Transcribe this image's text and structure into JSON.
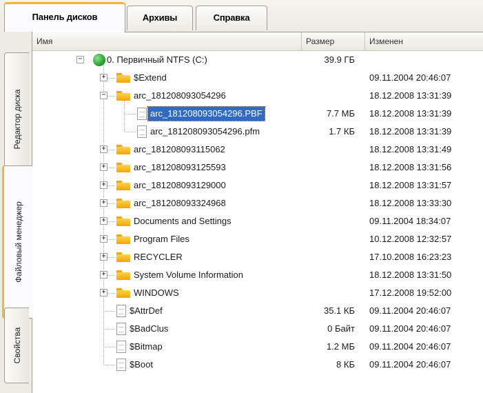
{
  "tabs": [
    {
      "label": "Панель дисков",
      "active": true
    },
    {
      "label": "Архивы",
      "active": false
    },
    {
      "label": "Справка",
      "active": false
    }
  ],
  "side_tabs": [
    {
      "label": "Редактор диска",
      "active": false
    },
    {
      "label": "Файловый менеджер",
      "active": true
    },
    {
      "label": "Свойства",
      "active": false
    }
  ],
  "columns": {
    "name": "Имя",
    "size": "Размер",
    "modified": "Изменен"
  },
  "rows": [
    {
      "name": "0. Первичный NTFS (C:)",
      "size": "39.9 ГБ",
      "date": "",
      "level": 0,
      "icon": "drive-icon",
      "expander": "minus"
    },
    {
      "name": "$Extend",
      "size": "",
      "date": "09.11.2004 20:46:07",
      "level": 1,
      "icon": "folder-icon",
      "expander": "plus"
    },
    {
      "name": "arc_181208093054296",
      "size": "",
      "date": "18.12.2008 13:31:39",
      "level": 1,
      "icon": "folder-icon",
      "expander": "minus"
    },
    {
      "name": "arc_181208093054296.PBF",
      "size": "7.7 МБ",
      "date": "18.12.2008 13:31:39",
      "level": 2,
      "icon": "file-icon",
      "expander": "none",
      "selected": true
    },
    {
      "name": "arc_181208093054296.pfm",
      "size": "1.7 КБ",
      "date": "18.12.2008 13:31:39",
      "level": 2,
      "icon": "file-icon",
      "expander": "none"
    },
    {
      "name": "arc_181208093115062",
      "size": "",
      "date": "18.12.2008 13:31:49",
      "level": 1,
      "icon": "folder-icon",
      "expander": "plus"
    },
    {
      "name": "arc_181208093125593",
      "size": "",
      "date": "18.12.2008 13:31:56",
      "level": 1,
      "icon": "folder-icon",
      "expander": "plus"
    },
    {
      "name": "arc_181208093129000",
      "size": "",
      "date": "18.12.2008 13:31:57",
      "level": 1,
      "icon": "folder-icon",
      "expander": "plus"
    },
    {
      "name": "arc_181208093324968",
      "size": "",
      "date": "18.12.2008 13:33:30",
      "level": 1,
      "icon": "folder-icon",
      "expander": "plus"
    },
    {
      "name": "Documents and Settings",
      "size": "",
      "date": "09.11.2004 18:34:07",
      "level": 1,
      "icon": "folder-icon",
      "expander": "plus"
    },
    {
      "name": "Program Files",
      "size": "",
      "date": "10.12.2008 12:32:57",
      "level": 1,
      "icon": "folder-icon",
      "expander": "plus"
    },
    {
      "name": "RECYCLER",
      "size": "",
      "date": "17.10.2008 16:23:23",
      "level": 1,
      "icon": "folder-icon",
      "expander": "plus"
    },
    {
      "name": "System Volume Information",
      "size": "",
      "date": "18.12.2008 13:31:50",
      "level": 1,
      "icon": "folder-icon",
      "expander": "plus"
    },
    {
      "name": "WINDOWS",
      "size": "",
      "date": "17.12.2008 19:52:00",
      "level": 1,
      "icon": "folder-icon",
      "expander": "plus"
    },
    {
      "name": "$AttrDef",
      "size": "35.1 КБ",
      "date": "09.11.2004 20:46:07",
      "level": 1,
      "icon": "file-icon",
      "expander": "none"
    },
    {
      "name": "$BadClus",
      "size": "0 Байт",
      "date": "09.11.2004 20:46:07",
      "level": 1,
      "icon": "file-icon",
      "expander": "none"
    },
    {
      "name": "$Bitmap",
      "size": "1.2 МБ",
      "date": "09.11.2004 20:46:07",
      "level": 1,
      "icon": "file-icon",
      "expander": "none"
    },
    {
      "name": "$Boot",
      "size": "8 КБ",
      "date": "09.11.2004 20:46:07",
      "level": 1,
      "icon": "file-icon",
      "expander": "none"
    }
  ]
}
